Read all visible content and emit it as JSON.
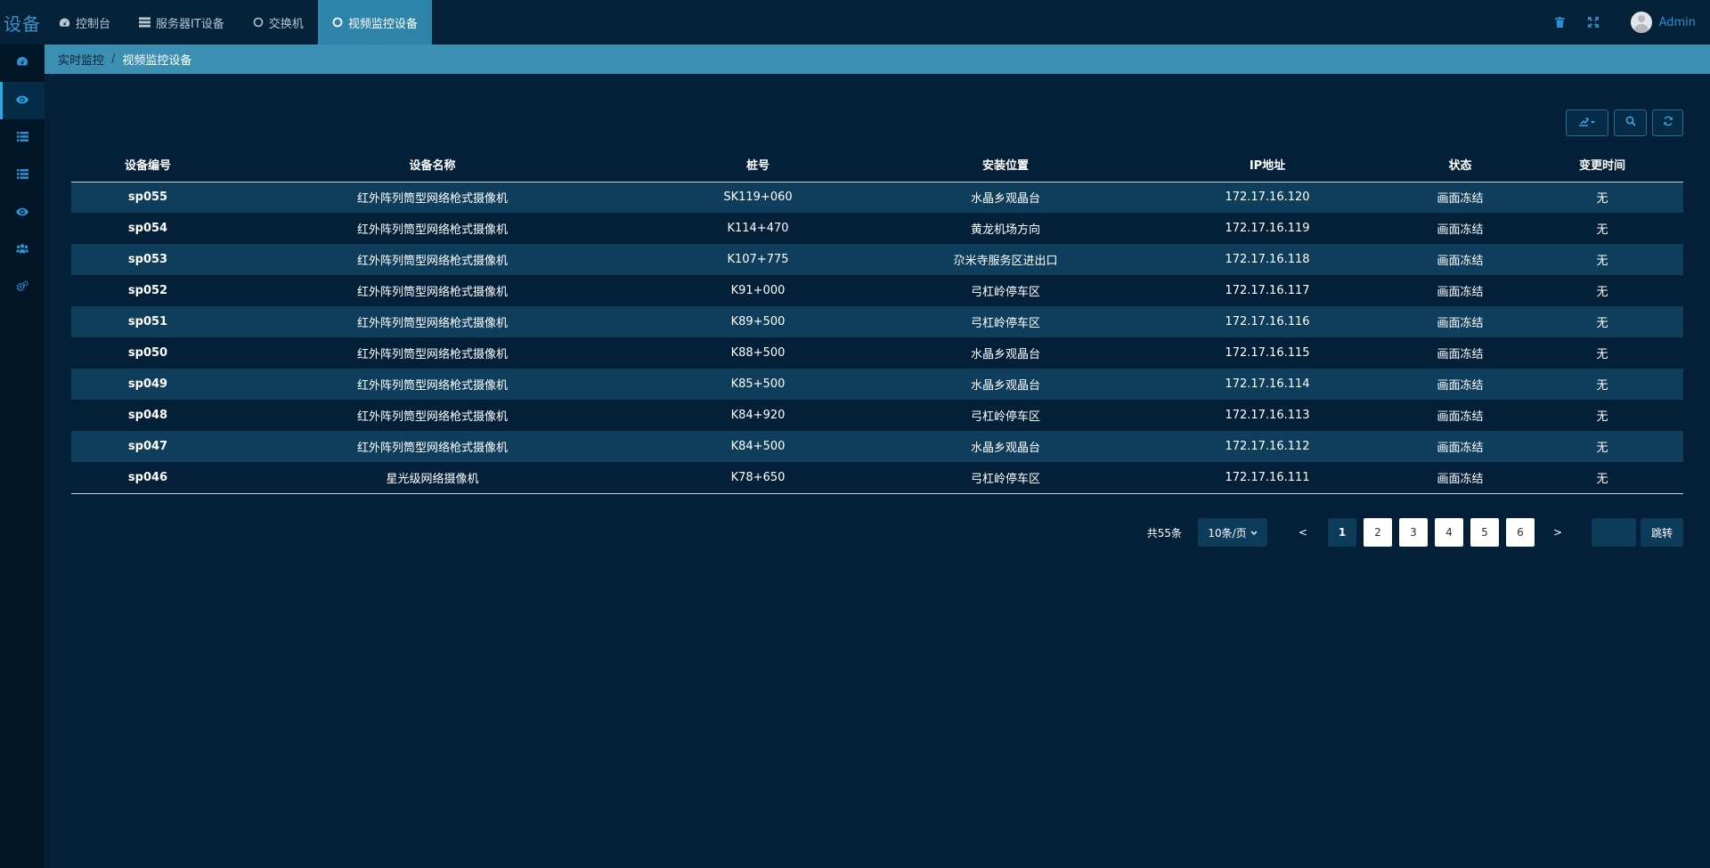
{
  "app": {
    "logo_text": "设备"
  },
  "nav": {
    "items": [
      {
        "label": "控制台",
        "icon": "dashboard-icon"
      },
      {
        "label": "服务器IT设备",
        "icon": "server-icon"
      },
      {
        "label": "交换机",
        "icon": "circle-icon"
      },
      {
        "label": "视频监控设备",
        "icon": "circle-icon",
        "active": true
      }
    ]
  },
  "header": {
    "user_name": "Admin"
  },
  "sidebar": {
    "items": [
      "dashboard-icon",
      "eye-icon",
      "list-icon",
      "list-icon",
      "eye-icon",
      "users-icon",
      "cogs-icon"
    ],
    "active_index": 1
  },
  "breadcrumb": {
    "parent": "实时监控",
    "separator": "/",
    "current": "视频监控设备"
  },
  "table": {
    "columns": [
      "设备编号",
      "设备名称",
      "桩号",
      "安装位置",
      "IP地址",
      "状态",
      "变更时间"
    ],
    "rows": [
      [
        "sp055",
        "红外阵列筒型网络枪式摄像机",
        "SK119+060",
        "水晶乡观晶台",
        "172.17.16.120",
        "画面冻结",
        "无"
      ],
      [
        "sp054",
        "红外阵列筒型网络枪式摄像机",
        "K114+470",
        "黄龙机场方向",
        "172.17.16.119",
        "画面冻结",
        "无"
      ],
      [
        "sp053",
        "红外阵列筒型网络枪式摄像机",
        "K107+775",
        "尕米寺服务区进出口",
        "172.17.16.118",
        "画面冻结",
        "无"
      ],
      [
        "sp052",
        "红外阵列筒型网络枪式摄像机",
        "K91+000",
        "弓杠岭停车区",
        "172.17.16.117",
        "画面冻结",
        "无"
      ],
      [
        "sp051",
        "红外阵列筒型网络枪式摄像机",
        "K89+500",
        "弓杠岭停车区",
        "172.17.16.116",
        "画面冻结",
        "无"
      ],
      [
        "sp050",
        "红外阵列筒型网络枪式摄像机",
        "K88+500",
        "水晶乡观晶台",
        "172.17.16.115",
        "画面冻结",
        "无"
      ],
      [
        "sp049",
        "红外阵列筒型网络枪式摄像机",
        "K85+500",
        "水晶乡观晶台",
        "172.17.16.114",
        "画面冻结",
        "无"
      ],
      [
        "sp048",
        "红外阵列筒型网络枪式摄像机",
        "K84+920",
        "弓杠岭停车区",
        "172.17.16.113",
        "画面冻结",
        "无"
      ],
      [
        "sp047",
        "红外阵列筒型网络枪式摄像机",
        "K84+500",
        "水晶乡观晶台",
        "172.17.16.112",
        "画面冻结",
        "无"
      ],
      [
        "sp046",
        "星光级网络摄像机",
        "K78+650",
        "弓杠岭停车区",
        "172.17.16.111",
        "画面冻结",
        "无"
      ]
    ]
  },
  "pagination": {
    "total_text": "共55条",
    "page_size": "10条/页",
    "prev": "<",
    "next": ">",
    "pages": [
      "1",
      "2",
      "3",
      "4",
      "5",
      "6"
    ],
    "current_page": "1",
    "jump_label": "跳转",
    "jump_value": ""
  },
  "colors": {
    "background": "#032038",
    "accent": "#2e84a8",
    "breadcrumb": "#3a8fb3",
    "row_alt": "#0f3e5c",
    "icon": "#2f8fd3"
  }
}
